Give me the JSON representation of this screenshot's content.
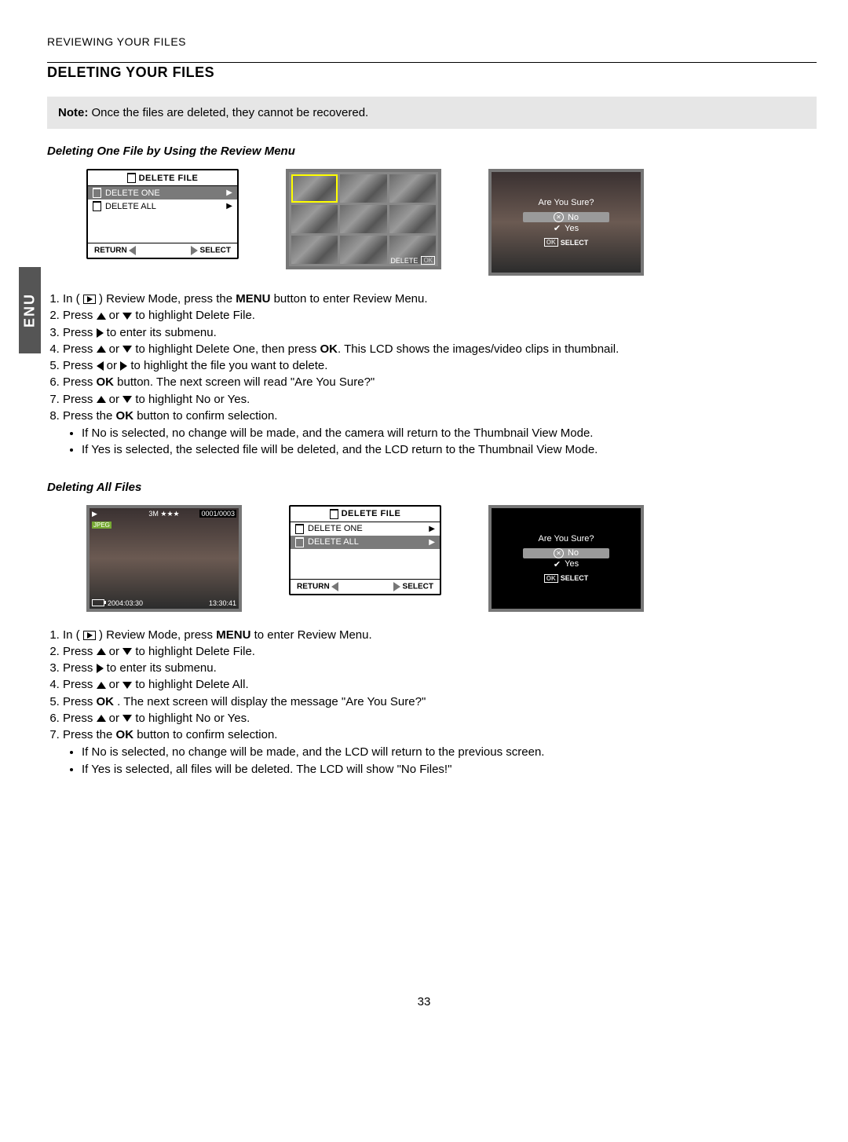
{
  "side_tab": "ENU",
  "running_header": "REVIEWING YOUR FILES",
  "section_title": "DELETING YOUR FILES",
  "note_label": "Note:",
  "note_text": " Once the files are deleted, they cannot be recovered.",
  "sub1_title": "Deleting One File by Using the Review Menu",
  "sub2_title": "Deleting All Files",
  "menu": {
    "title": "DELETE FILE",
    "opt1": "DELETE ONE",
    "opt2": "DELETE ALL",
    "return": "RETURN",
    "select": "SELECT"
  },
  "thumb_footer": "DELETE",
  "confirm": {
    "question": "Are You Sure?",
    "no": "No",
    "yes": "Yes",
    "select": "SELECT",
    "ok": "OK"
  },
  "photo": {
    "res": "3M",
    "stars": "★★★",
    "counter": "0001/0003",
    "jpeg": "JPEG",
    "date": "2004:03:30",
    "time": "13:30:41"
  },
  "steps1": {
    "s1a": "In ( ",
    "s1b": " ) Review Mode, press the ",
    "s1c": "MENU",
    "s1d": " button to enter Review Menu.",
    "s2a": "Press ",
    "s2b": " or ",
    "s2c": " to highlight Delete File.",
    "s3a": "Press ",
    "s3b": " to enter its submenu.",
    "s4a": "Press ",
    "s4b": " or ",
    "s4c": " to highlight Delete One, then press ",
    "s4d": "OK",
    "s4e": ". This LCD shows the images/video clips in thumbnail.",
    "s5a": "Press ",
    "s5b": " or ",
    "s5c": " to highlight the file you want to delete.",
    "s6a": "Press ",
    "s6b": "OK",
    "s6c": " button.  The next screen will read \"Are You Sure?\"",
    "s7a": "Press ",
    "s7b": " or ",
    "s7c": " to highlight No or Yes.",
    "s8a": "Press the ",
    "s8b": "OK",
    "s8c": " button to confirm selection.",
    "b1": "If No is selected, no change will be made, and the camera will return to the Thumbnail View Mode.",
    "b2": "If Yes is selected, the selected file will be deleted, and the LCD return to the Thumbnail View Mode."
  },
  "steps2": {
    "s1a": "In ( ",
    "s1b": " ) Review Mode, press ",
    "s1c": "MENU",
    "s1d": " to enter Review Menu.",
    "s2a": "Press ",
    "s2b": " or ",
    "s2c": " to highlight Delete File.",
    "s3a": "Press ",
    "s3b": " to enter its submenu.",
    "s4a": "Press ",
    "s4b": " or ",
    "s4c": " to highlight Delete All.",
    "s5a": "Press  ",
    "s5b": "OK",
    "s5c": " . The next screen will display the message \"Are You Sure?\"",
    "s6a": "Press ",
    "s6b": " or ",
    "s6c": " to highlight No or Yes.",
    "s7a": "Press the ",
    "s7b": "OK",
    "s7c": " button to confirm selection.",
    "b1": "If No is selected, no change will be made, and the LCD will return to the previous screen.",
    "b2": "If Yes is selected, all files will be deleted. The LCD will show \"No Files!\""
  },
  "page_number": "33"
}
